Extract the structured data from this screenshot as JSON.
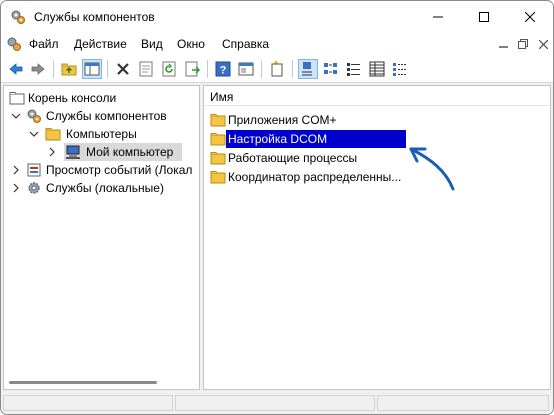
{
  "window": {
    "title": "Службы компонентов"
  },
  "menu": {
    "items": [
      "Файл",
      "Действие",
      "Вид",
      "Окно",
      "Справка"
    ]
  },
  "toolbar": {
    "buttons": [
      "back-icon",
      "forward-icon",
      "up-folder-icon",
      "show-hide-tree-icon",
      "delete-icon",
      "properties-icon",
      "refresh-icon",
      "export-icon",
      "help-icon",
      "console-icon",
      "new-item-icon",
      "large-icons-view-icon",
      "small-icons-view-icon",
      "list-view-icon",
      "detail-view-icon"
    ]
  },
  "tree": {
    "items": [
      {
        "label": "Корень консоли",
        "level": 0
      },
      {
        "label": "Службы компонентов",
        "level": 1
      },
      {
        "label": "Компьютеры",
        "level": 2
      },
      {
        "label": "Мой компьютер",
        "level": 3
      },
      {
        "label": "Просмотр событий (Локал",
        "level": 1
      },
      {
        "label": "Службы (локальные)",
        "level": 1
      }
    ]
  },
  "list": {
    "column_header": "Имя",
    "items": [
      {
        "label": "Приложения COM+"
      },
      {
        "label": "Настройка DCOM"
      },
      {
        "label": "Работающие процессы"
      },
      {
        "label": "Координатор распределенны..."
      }
    ]
  },
  "colors": {
    "highlight": "#0000cc",
    "annotation_arrow": "#1a5fb4",
    "folder": "#f4c542"
  }
}
